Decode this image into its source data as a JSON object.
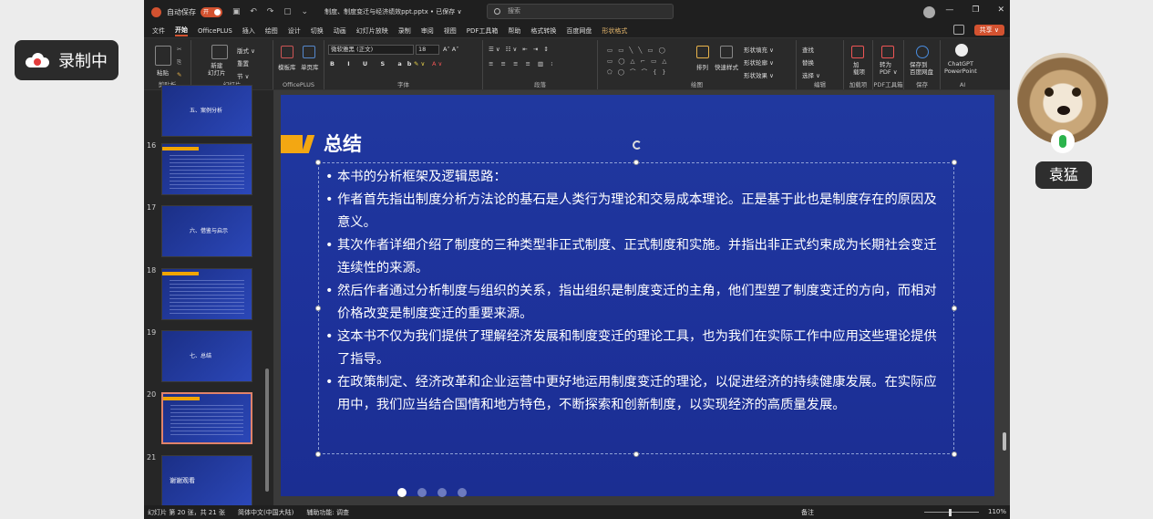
{
  "recording": {
    "label": "录制中"
  },
  "participant": {
    "name": "袁猛"
  },
  "window": {
    "autosave_label": "自动保存",
    "autosave_toggle": "开",
    "doc_title": "制度、制度变迁与经济绩效ppt.pptx • 已保存 ∨",
    "search_placeholder": "搜索",
    "minimize": "—",
    "restore": "❐",
    "close": "✕"
  },
  "tabs": [
    "文件",
    "开始",
    "OfficePLUS",
    "插入",
    "绘图",
    "设计",
    "切换",
    "动画",
    "幻灯片放映",
    "录制",
    "审阅",
    "视图",
    "PDF工具箱",
    "帮助",
    "格式转换",
    "百度网盘",
    "形状格式"
  ],
  "active_tab": "开始",
  "share_label": "共享 ∨",
  "ribbon": {
    "groups": {
      "clipboard": "剪贴板",
      "slides": "幻灯片",
      "officeplus": "OfficePLUS",
      "font": "字体",
      "paragraph": "段落",
      "drawing": "绘图",
      "editing": "编辑",
      "addins": "加载项",
      "pdf": "PDF工具箱",
      "save": "保存",
      "ai": "AI"
    },
    "labels": {
      "paste": "粘贴",
      "new_slide": "新建\n幻灯片",
      "layout": "版式 ∨",
      "reset": "重置",
      "section": "节 ∨",
      "template_lib": "模板库",
      "single_lib": "单页库",
      "font_name": "微软雅黑 (正文)",
      "font_size": "18",
      "arrange": "排列",
      "quick_styles": "快速样式",
      "shape_fill": "形状填充 ∨",
      "shape_outline": "形状轮廓 ∨",
      "shape_effects": "形状效果 ∨",
      "find": "查找",
      "replace": "替换",
      "select": "选择 ∨",
      "addins": "加\n载项",
      "to_pdf": "转为\nPDF ∨",
      "save_baidu": "保存到\n百度网盘",
      "chatgpt": "ChatGPT\nPowerPoint"
    }
  },
  "thumbnails": [
    {
      "num": "",
      "title": "五、案例分析",
      "kind": "section"
    },
    {
      "num": "16",
      "title": "",
      "kind": "text"
    },
    {
      "num": "17",
      "title": "六、借鉴与启示",
      "kind": "section"
    },
    {
      "num": "18",
      "title": "",
      "kind": "text"
    },
    {
      "num": "19",
      "title": "七、总结",
      "kind": "section"
    },
    {
      "num": "20",
      "title": "",
      "kind": "text",
      "selected": true
    },
    {
      "num": "21",
      "title": "谢谢观看",
      "kind": "section"
    }
  ],
  "slide": {
    "title": "总结",
    "bullets": [
      "本书的分析框架及逻辑思路：",
      "作者首先指出制度分析方法论的基石是人类行为理论和交易成本理论。正是基于此也是制度存在的原因及意义。",
      "其次作者详细介绍了制度的三种类型非正式制度、正式制度和实施。并指出非正式约束成为长期社会变迁连续性的来源。",
      "然后作者通过分析制度与组织的关系，指出组织是制度变迁的主角，他们型塑了制度变迁的方向，而相对价格改变是制度变迁的重要来源。",
      "这本书不仅为我们提供了理解经济发展和制度变迁的理论工具，也为我们在实际工作中应用这些理论提供了指导。",
      "在政策制定、经济改革和企业运营中更好地运用制度变迁的理论，以促进经济的持续健康发展。在实际应用中，我们应当结合国情和地方特色，不断探索和创新制度，以实现经济的高质量发展。"
    ]
  },
  "status": {
    "slide_info": "幻灯片 第 20 张，共 21 张",
    "language": "简体中文(中国大陆)",
    "accessibility": "辅助功能: 调查",
    "notes": "备注",
    "zoom": "110%"
  }
}
